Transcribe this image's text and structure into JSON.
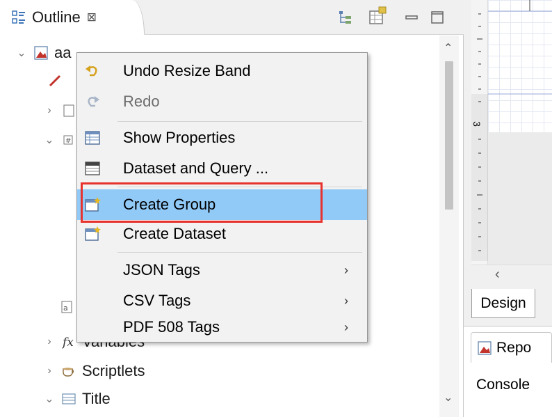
{
  "outline": {
    "tab_title": "Outline",
    "close_glyph": "⊠",
    "tree": [
      {
        "label": "aa",
        "expanded": true,
        "icon": "report-icon"
      },
      {
        "label": "",
        "icon": "pencil-icon"
      },
      {
        "label": "",
        "expanded": false,
        "icon": "dataset-icon"
      },
      {
        "label": "",
        "expanded": true,
        "icon": "parameters-icon"
      },
      {
        "label": "",
        "icon": "field-icon"
      },
      {
        "label": "Variables",
        "expanded": false,
        "icon": "fx-icon"
      },
      {
        "label": "Scriptlets",
        "expanded": false,
        "icon": "coffee-cup-icon"
      },
      {
        "label": "Title",
        "expanded": true,
        "icon": "band-icon"
      }
    ]
  },
  "context_menu": {
    "items": [
      {
        "label": "Undo Resize Band",
        "icon": "undo-arrow-icon",
        "enabled": true
      },
      {
        "label": "Redo",
        "icon": "redo-arrow-icon",
        "enabled": false
      },
      {
        "label": "Show Properties",
        "icon": "properties-table-icon",
        "enabled": true
      },
      {
        "label": "Dataset and Query ...",
        "icon": "dataset-query-icon",
        "enabled": true
      },
      {
        "label": "Create Group",
        "icon": "create-group-icon",
        "enabled": true,
        "highlighted": true
      },
      {
        "label": "Create Dataset",
        "icon": "create-dataset-icon",
        "enabled": true
      },
      {
        "label": "JSON Tags",
        "submenu": true,
        "enabled": true
      },
      {
        "label": "CSV Tags",
        "submenu": true,
        "enabled": true
      },
      {
        "label": "PDF 508 Tags",
        "submenu": true,
        "enabled": true
      }
    ],
    "submenu_glyph": "›",
    "highlight_color": "#91c9f7",
    "annotation_color": "#e8322e"
  },
  "editor": {
    "ruler_mark": "3",
    "left_arrow": "‹",
    "design_tab": "Design",
    "report_tab": "Repo",
    "console_label": "Console"
  },
  "scroll": {
    "up": "⌃",
    "down": "⌄"
  }
}
